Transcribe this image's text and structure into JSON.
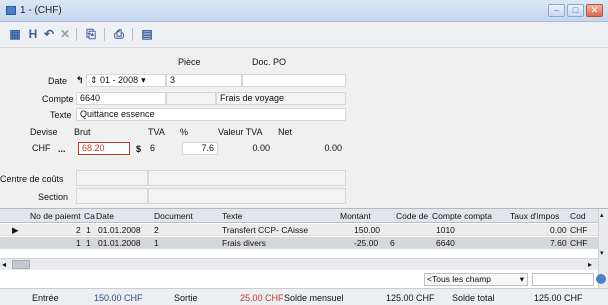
{
  "window": {
    "title": "1 - (CHF)",
    "buttons": {
      "minimize": "–",
      "maximize": "□",
      "close": "✕"
    }
  },
  "toolbar": {
    "icons": [
      "grid-icon",
      "save-icon",
      "undo-icon",
      "delete-icon",
      "copy-icon",
      "print-icon",
      "report-icon"
    ]
  },
  "form": {
    "piece_header": "Pièce",
    "docpo_header": "Doc. PO",
    "date_label": "Date",
    "date_value": "01 - 2008",
    "piece_value": "3",
    "compte_label": "Compte",
    "compte_value": "6640",
    "compte_name": "Frais de voyage",
    "texte_label": "Texte",
    "texte_value": "Quittance essence",
    "devise_header": "Devise",
    "brut_header": "Brut",
    "tva_header": "TVA",
    "pct_header": "%",
    "valeur_tva_header": "Valeur TVA",
    "net_header": "Net",
    "devise_value": "CHF",
    "ellipsis": "...",
    "brut_value": "68.20",
    "tva_code": "6",
    "pct_value": "7.6",
    "valeur_tva_value": "0.00",
    "net_value": "0.00",
    "centre_label": "Centre de coûts",
    "section_label": "Section"
  },
  "grid": {
    "columns": [
      "No de paiemt",
      "Ca",
      "Date",
      "Document",
      "Texte",
      "Montant",
      "Code de",
      "Compte compta",
      "Taux d'impos",
      "Cod"
    ],
    "rows": [
      {
        "no": "2",
        "ca": "1",
        "date": "01.01.2008",
        "document": "2",
        "texte": "Transfert CCP- CAisse",
        "montant": "150.00",
        "code": "",
        "compte": "1010",
        "taux": "0.00",
        "cur": "CHF"
      },
      {
        "no": "1",
        "ca": "1",
        "date": "01.01.2008",
        "document": "1",
        "texte": "Frais divers",
        "montant": "-25.00",
        "code": "6",
        "compte": "6640",
        "taux": "7.60",
        "cur": "CHF"
      }
    ],
    "filter": "<Tous les champ"
  },
  "footer": {
    "entree_label": "Entrée",
    "entree_value": "150.00 CHF",
    "sortie_label": "Sortie",
    "sortie_value": "25.00 CHF",
    "solde_mensuel_label": "Solde mensuel",
    "solde_mensuel_value": "125.00 CHF",
    "solde_total_label": "Solde total",
    "solde_total_value": "125.00 CHF"
  },
  "colors": {
    "accent": "#4d7fc4",
    "negative": "#c0392b",
    "grid_header": "#e2e5ea"
  }
}
